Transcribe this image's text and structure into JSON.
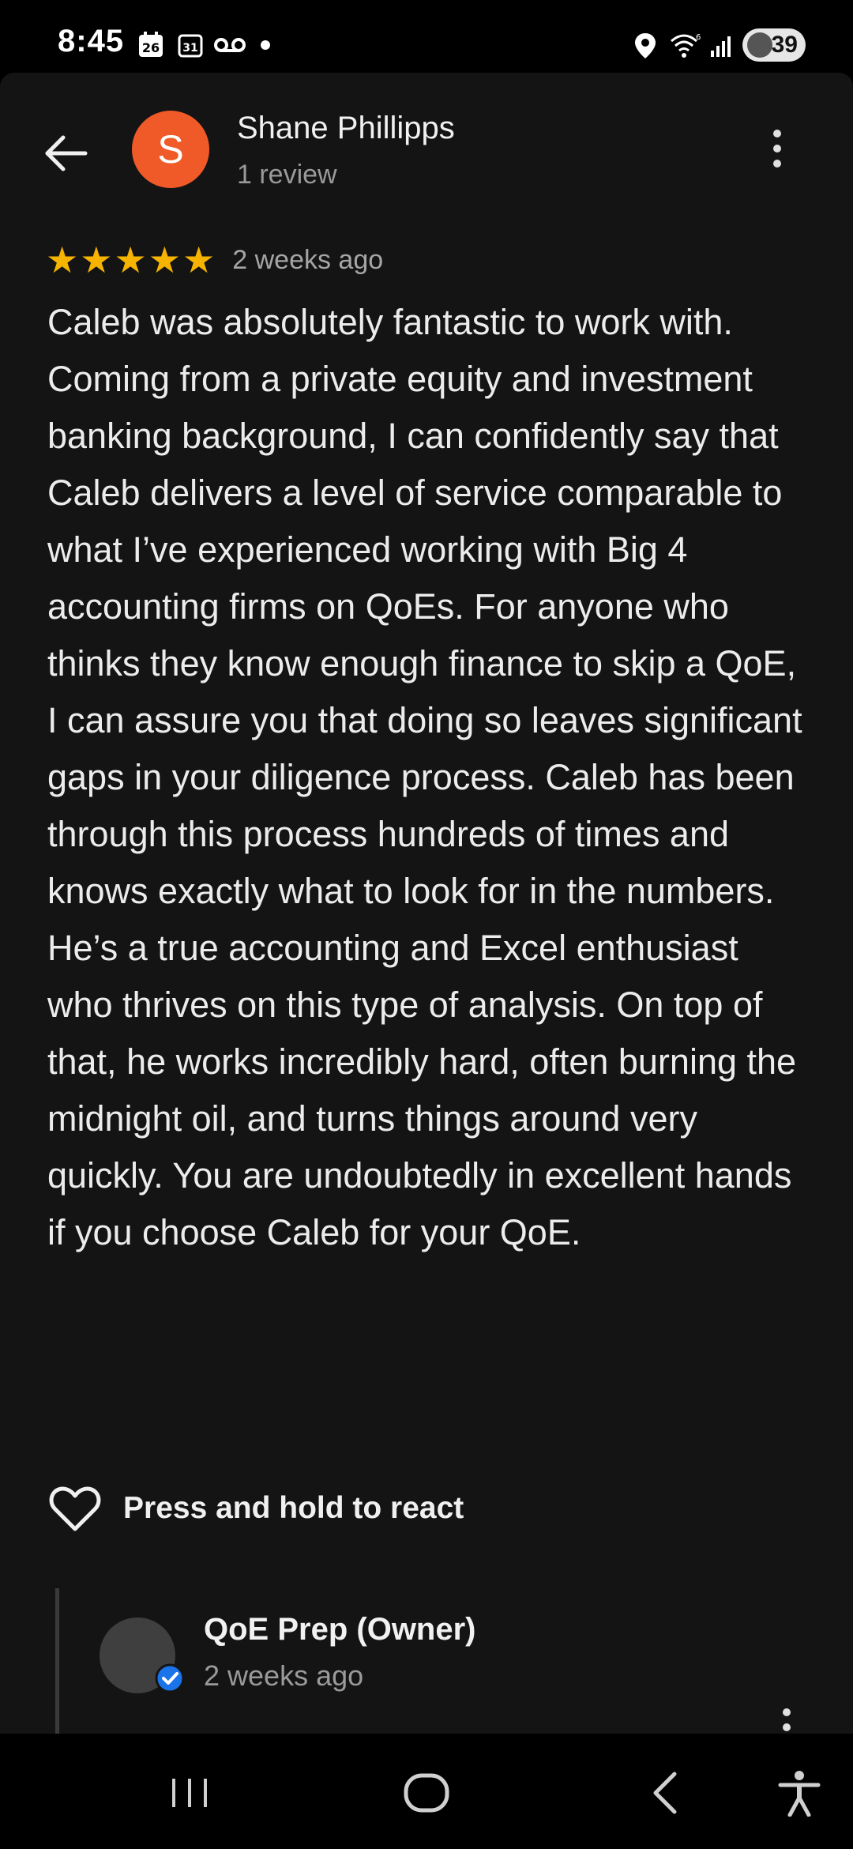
{
  "status_bar": {
    "time": "8:45",
    "battery": "39",
    "icons": [
      "calendar-26-icon",
      "calendar-31-icon",
      "voicemail-icon",
      "dot-icon",
      "location-icon",
      "wifi-icon",
      "signal-icon",
      "battery-icon"
    ],
    "calendar_day_a": "26",
    "calendar_day_b": "31"
  },
  "header": {
    "avatar_initial": "S",
    "avatar_color": "#f05a28",
    "reviewer_name": "Shane Phillipps",
    "review_count": "1 review"
  },
  "review": {
    "stars": 5,
    "date": "2 weeks ago",
    "text": "Caleb was absolutely fantastic to work with. Coming from a private equity and investment banking background, I can confidently say that Caleb delivers a level of service comparable to what I’ve experienced working with Big 4 accounting firms on QoEs. For anyone who thinks they know enough finance to skip a QoE, I can assure you that doing so leaves significant gaps in your diligence process. Caleb has been through this process hundreds of times and knows exactly what to look for in the numbers. He’s a true accounting and Excel enthusiast who thrives on this type of analysis. On top of that, he works incredibly hard, often burning the midnight oil, and turns things around very quickly. You are undoubtedly in excellent hands if you choose Caleb for your QoE."
  },
  "react": {
    "label": "Press and hold to react"
  },
  "owner_reply": {
    "name": "QoE Prep (Owner)",
    "date": "2 weeks ago"
  },
  "colors": {
    "star": "#f6b400",
    "verified": "#1a73e8",
    "background": "#141414"
  }
}
